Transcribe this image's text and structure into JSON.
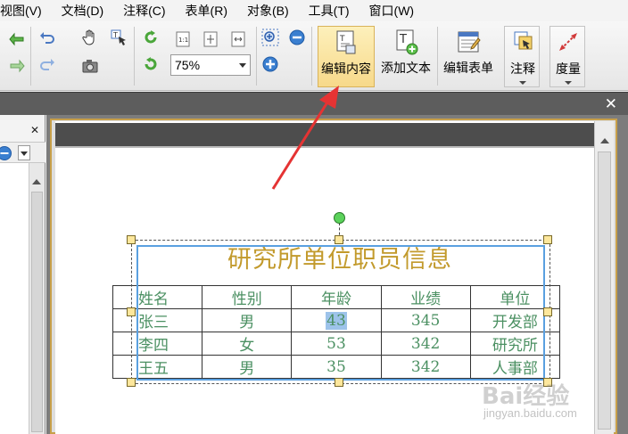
{
  "menu": {
    "items": [
      "视图(V)",
      "文档(D)",
      "注释(C)",
      "表单(R)",
      "对象(B)",
      "工具(T)",
      "窗口(W)"
    ]
  },
  "toolbar": {
    "zoom_value": "75%",
    "buttons": {
      "edit_content": "编辑内容",
      "add_text": "添加文本",
      "edit_form": "编辑表单",
      "annotate": "注释",
      "measure": "度量"
    },
    "icons": [
      "back-arrow-icon",
      "forward-arrow-icon",
      "undo-icon",
      "redo-icon",
      "hand-icon",
      "select-text-icon",
      "camera-icon",
      "rotate-cw-icon",
      "rotate-ccw-icon",
      "actual-size-icon",
      "fit-page-icon",
      "fit-width-icon",
      "zoom-in-region-icon",
      "zoom-out-icon",
      "zoom-in-icon"
    ]
  },
  "document": {
    "title": "研究所单位职员信息",
    "table": {
      "headers": [
        "姓名",
        "性别",
        "年龄",
        "业绩",
        "单位"
      ],
      "rows": [
        [
          "张三",
          "男",
          "43",
          "345",
          "开发部"
        ],
        [
          "李四",
          "女",
          "53",
          "342",
          "研究所"
        ],
        [
          "王五",
          "男",
          "35",
          "342",
          "人事部"
        ]
      ]
    },
    "selected_cell_text": "43"
  },
  "colors": {
    "title": "#c29a2c",
    "table_text": "#4b9062",
    "selection_border": "#5aa0e0",
    "active_button": "#f7d98a",
    "arrow": "#e53333"
  },
  "watermark": {
    "brand": "Bai经验",
    "url": "jingyan.baidu.com"
  }
}
